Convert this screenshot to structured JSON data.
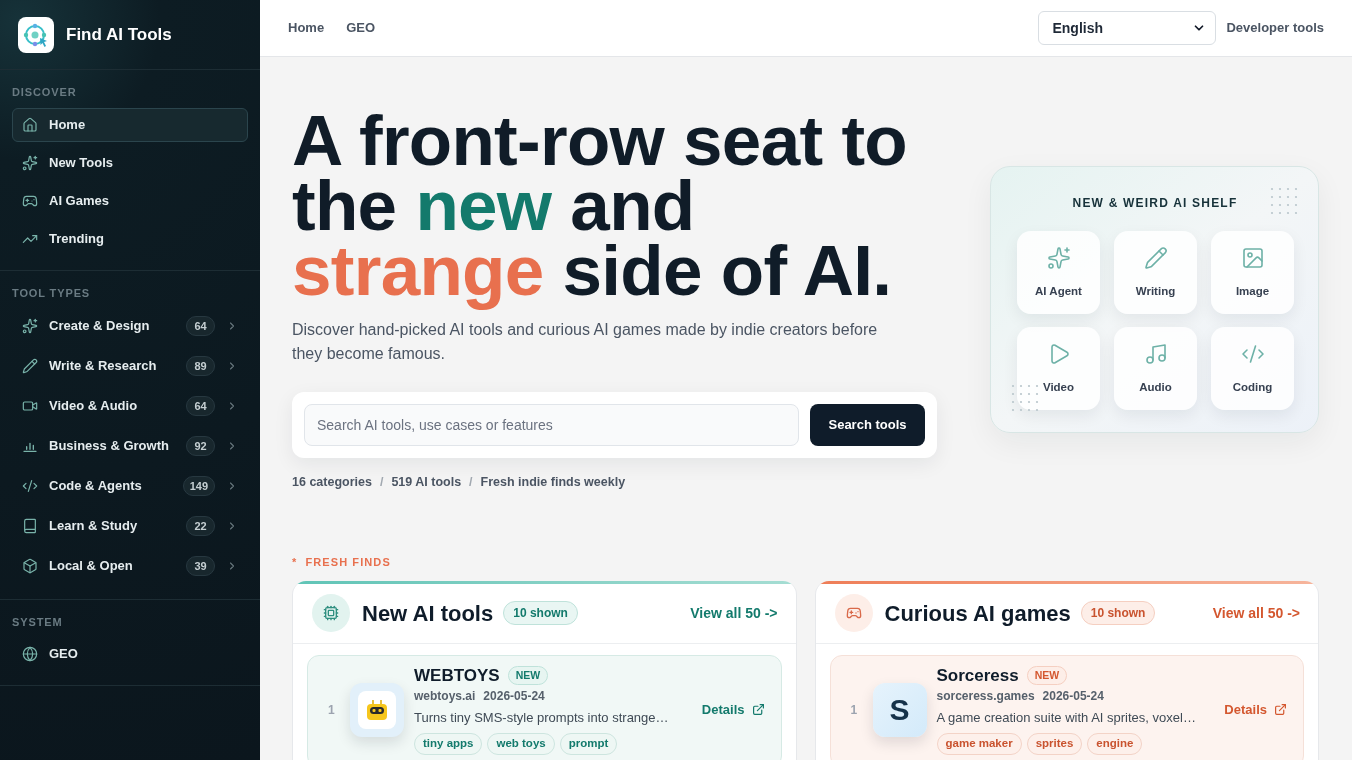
{
  "sidebar": {
    "brand": "Find AI Tools",
    "sections": [
      {
        "heading": "DISCOVER",
        "items": [
          {
            "label": "Home",
            "selected": true
          },
          {
            "label": "New Tools",
            "selected": false
          },
          {
            "label": "AI Games",
            "selected": false
          },
          {
            "label": "Trending",
            "selected": false
          }
        ]
      },
      {
        "heading": "TOOL TYPES",
        "items": [
          {
            "label": "Create & Design",
            "count": "64",
            "selected": false
          },
          {
            "label": "Write & Research",
            "count": "89",
            "selected": false
          },
          {
            "label": "Video & Audio",
            "count": "64",
            "selected": false
          },
          {
            "label": "Business & Growth",
            "count": "92",
            "selected": false
          },
          {
            "label": "Code & Agents",
            "count": "149",
            "selected": false
          },
          {
            "label": "Learn & Study",
            "count": "22",
            "selected": false
          },
          {
            "label": "Local & Open",
            "count": "39",
            "selected": false
          }
        ]
      },
      {
        "heading": "SYSTEM",
        "items": [
          {
            "label": "GEO",
            "selected": false
          }
        ]
      }
    ]
  },
  "header": {
    "nav": [
      {
        "label": "Home"
      },
      {
        "label": "GEO"
      }
    ],
    "language": {
      "value": "English"
    },
    "link": "Developer tools"
  },
  "hero": {
    "title": [
      {
        "text": "A front-row seat to the ",
        "color": "#101c28"
      },
      {
        "text": "new",
        "color": "#137a6c"
      },
      {
        "text": " and ",
        "color": "#101c28"
      },
      {
        "text": "strange",
        "color": "#e8704e"
      },
      {
        "text": " side of AI.",
        "color": "#101c28"
      }
    ],
    "subtitle": "Discover hand-picked AI tools and curious AI games made by indie creators before they become famous.",
    "search": {
      "placeholder": "Search AI tools, use cases or features",
      "button": "Search tools"
    },
    "stats": {
      "items": [
        "16 categories",
        "519 AI tools",
        "Fresh indie finds weekly"
      ],
      "separator": "/"
    }
  },
  "shelf": {
    "title": "NEW & WEIRD AI SHELF",
    "items": [
      {
        "label": "AI Agent"
      },
      {
        "label": "Writing"
      },
      {
        "label": "Image"
      },
      {
        "label": "Video"
      },
      {
        "label": "Audio"
      },
      {
        "label": "Coding"
      }
    ]
  },
  "fresh_finds": {
    "marker": "*",
    "label": "FRESH FINDS"
  },
  "panels": [
    {
      "kind": "tools",
      "title": "New AI tools",
      "badge": "10 shown",
      "link": "View all 50 ->",
      "items": [
        {
          "rank": "1",
          "logo": {
            "kind": "robot"
          },
          "name": "WEBTOYS",
          "badge": "NEW",
          "domain": "webtoys.ai",
          "date": "2026-05-24",
          "description": "Turns tiny SMS-style prompts into strange…",
          "tags": [
            "tiny apps",
            "web toys",
            "prompt"
          ],
          "action": "Details"
        }
      ]
    },
    {
      "kind": "games",
      "title": "Curious AI games",
      "badge": "10 shown",
      "link": "View all 50 ->",
      "items": [
        {
          "rank": "1",
          "logo": {
            "kind": "letter",
            "text": "S"
          },
          "name": "Sorceress",
          "badge": "NEW",
          "domain": "sorceress.games",
          "date": "2026-05-24",
          "description": "A game creation suite with AI sprites, voxel…",
          "tags": [
            "game maker",
            "sprites",
            "engine"
          ],
          "action": "Details"
        }
      ]
    }
  ]
}
